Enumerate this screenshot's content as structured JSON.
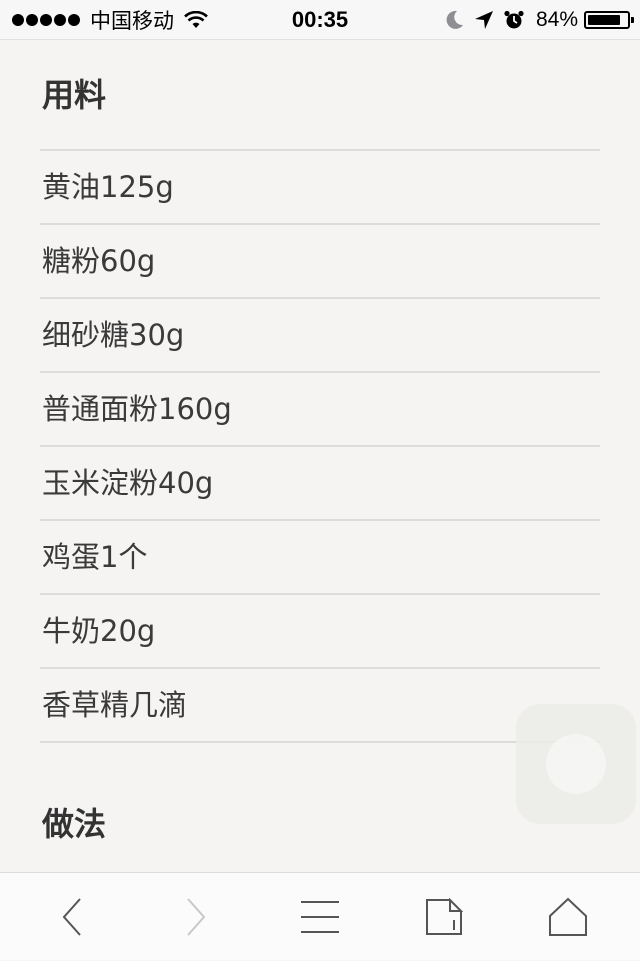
{
  "status_bar": {
    "carrier": "中国移动",
    "time": "00:35",
    "battery_percent": "84%",
    "battery_level": 0.84,
    "icons": [
      "signal-dots",
      "wifi-icon",
      "moon-icon",
      "location-arrow-icon",
      "alarm-icon",
      "battery-icon"
    ]
  },
  "ingredients_section": {
    "title": "用料",
    "items": [
      "黄油125g",
      "糖粉60g",
      "细砂糖30g",
      "普通面粉160g",
      "玉米淀粉40g",
      "鸡蛋1个",
      "牛奶20g",
      "香草精几滴"
    ]
  },
  "method_section": {
    "title": "做法"
  },
  "toolbar": {
    "buttons": [
      "back-icon",
      "forward-icon",
      "menu-icon",
      "tabs-icon",
      "home-icon"
    ],
    "colors": {
      "active": "#555555",
      "disabled": "#c8c8c8"
    }
  }
}
